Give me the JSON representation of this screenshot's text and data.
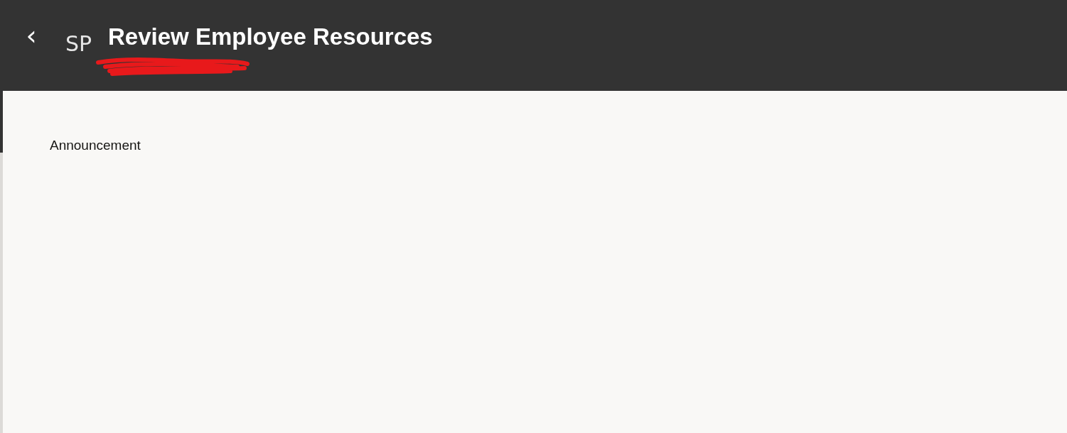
{
  "header": {
    "back": "‹",
    "avatar": "SP",
    "title": "Review Employee Resources"
  },
  "content": {
    "heading": "Announcement"
  }
}
